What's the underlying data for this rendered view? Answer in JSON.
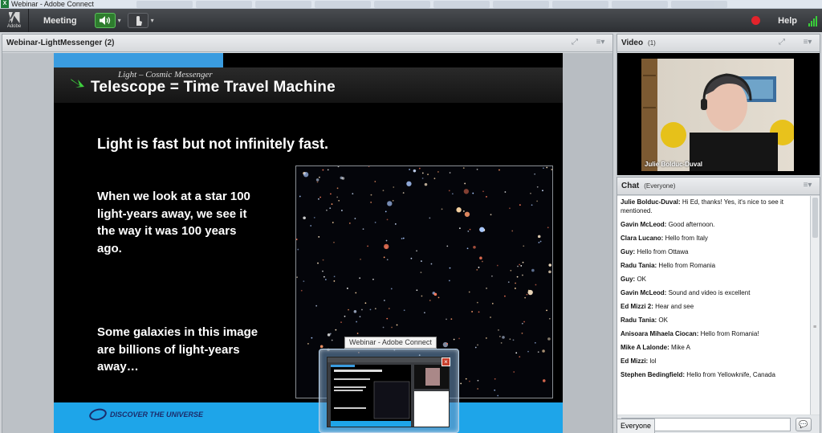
{
  "window": {
    "title": "Webinar - Adobe Connect",
    "app_icon": "X"
  },
  "toolbar": {
    "logo_text": "Adobe",
    "menu_meeting": "Meeting",
    "speaker_icon": "speaker-icon",
    "share_icon": "share-hand-icon",
    "help": "Help",
    "record_color": "#e3232b",
    "speaker_color": "#2e7d2e"
  },
  "share_pod": {
    "title": "Webinar-LightMessenger",
    "count": "(2)"
  },
  "slide": {
    "subtitle": "Light – Cosmic Messenger",
    "heading": "Telescope = Time Travel Machine",
    "line1": "Light is fast but not infinitely fast.",
    "para2": "When we look at a star 100\nlight-years away, we see it\nthe way it was 100 years\nago.",
    "para3": "Some galaxies in this image\nare billions of light-years\naway…",
    "footer_logo": "DISCOVER THE UNIVERSE",
    "accent_color": "#1ea5e9"
  },
  "taskbar_preview": {
    "tooltip": "Webinar - Adobe Connect",
    "close": "×"
  },
  "video_pod": {
    "title": "Video",
    "count": "(1)",
    "presenter": "Julie Bolduc-Duval"
  },
  "chat_pod": {
    "title": "Chat",
    "scope": "(Everyone)",
    "messages": [
      {
        "name": "Julie Bolduc-Duval:",
        "text": " Hi Ed, thanks! Yes, it's nice to see it mentioned."
      },
      {
        "name": "Gavin McLeod:",
        "text": " Good afternoon."
      },
      {
        "name": "Clara Lucano:",
        "text": " Hello from Italy"
      },
      {
        "name": "Guy:",
        "text": " Hello from Ottawa"
      },
      {
        "name": "Radu Tania:",
        "text": " Hello from Romania"
      },
      {
        "name": "Guy:",
        "text": " OK"
      },
      {
        "name": "Gavin McLeod:",
        "text": " Sound and video is excellent"
      },
      {
        "name": "Ed Mizzi 2:",
        "text": " Hear and see"
      },
      {
        "name": "Radu Tania:",
        "text": " OK"
      },
      {
        "name": "Anisoara Mihaela Ciocan:",
        "text": " Hello from Romania!"
      },
      {
        "name": "Mike A Lalonde:",
        "text": " Mike A"
      },
      {
        "name": "Ed Mizzi:",
        "text": " lol"
      },
      {
        "name": "Stephen Bedingfield:",
        "text": " Hello from Yellowknife, Canada"
      }
    ],
    "input_value": "",
    "send_icon": "speech-bubble-icon",
    "send_glyph": "💬",
    "recipient_tab": "Everyone"
  }
}
